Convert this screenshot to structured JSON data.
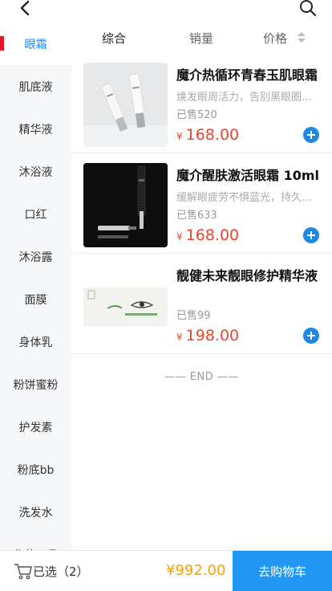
{
  "sidebar": {
    "items": [
      {
        "label": "眼霜"
      },
      {
        "label": "肌底液"
      },
      {
        "label": "精华液"
      },
      {
        "label": "沐浴液"
      },
      {
        "label": "口红"
      },
      {
        "label": "沐浴露"
      },
      {
        "label": "面膜"
      },
      {
        "label": "身体乳"
      },
      {
        "label": "粉饼蜜粉"
      },
      {
        "label": "护发素"
      },
      {
        "label": "粉底bb"
      },
      {
        "label": "洗发水"
      },
      {
        "label": "化妆工具"
      }
    ]
  },
  "sort": {
    "comprehensive": "综合",
    "sales": "销量",
    "price": "价格"
  },
  "products": [
    {
      "title": "魔介热循环青春玉肌眼霜",
      "desc": "焕发眼周活力，告别黑眼圈细纹",
      "sold": "已售520",
      "currency": "¥",
      "price": "168.00"
    },
    {
      "title": "魔介醒肤激活眼霜 10ml",
      "desc": "缓解眼疲劳不惧蓝光，持久保湿",
      "sold": "已售633",
      "currency": "¥",
      "price": "168.00"
    },
    {
      "title": "靓健未来靓眼修护精华液",
      "desc": "",
      "sold": "已售99",
      "currency": "¥",
      "price": "198.00"
    }
  ],
  "end_text": "—— END ——",
  "footer": {
    "selected": "已选（2）",
    "total": "¥992.00",
    "checkout": "去购物车"
  },
  "icons": {
    "back": "back-arrow-icon",
    "search": "search-icon",
    "cart": "cart-icon",
    "add": "plus-circle-icon"
  },
  "colors": {
    "accent": "#1e88e5",
    "price": "#e8462c",
    "total": "#f5a300",
    "checkout_bg": "#2196f3",
    "active_marker": "#e8192c"
  }
}
